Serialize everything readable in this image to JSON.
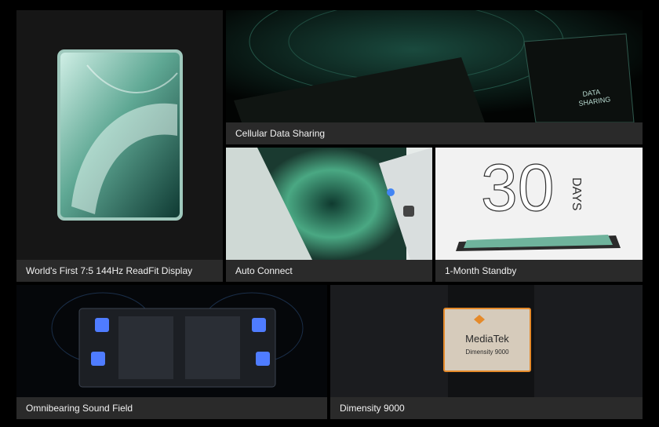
{
  "tiles": {
    "display": {
      "caption": "World's First 7:5 144Hz ReadFit Display"
    },
    "cellular": {
      "caption": "Cellular Data Sharing",
      "art_text_1": "DATA",
      "art_text_2": "SHARING"
    },
    "auto_connect": {
      "caption": "Auto Connect"
    },
    "standby": {
      "caption": "1-Month Standby",
      "big_number": "30",
      "unit_word": "DAYS"
    },
    "sound": {
      "caption": "Omnibearing Sound Field"
    },
    "chip": {
      "caption": "Dimensity 9000",
      "chip_brand": "MediaTek",
      "chip_model": "Dimensity 9000"
    }
  },
  "colors": {
    "accent_green": "#7ec2ad",
    "caption_bg": "#2a2a2a",
    "chip_orange": "#e58a2a"
  }
}
